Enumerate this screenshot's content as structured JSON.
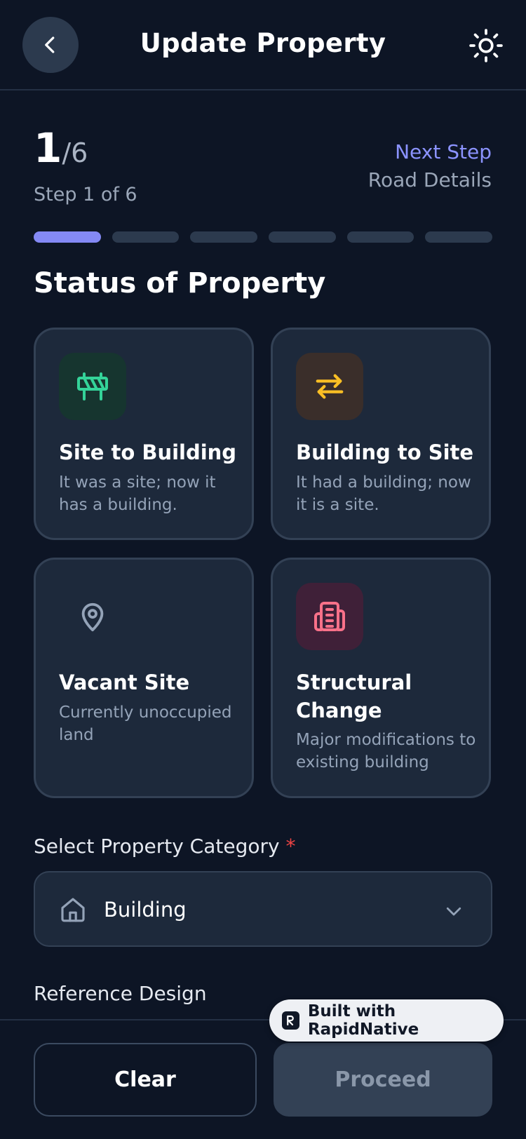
{
  "header": {
    "title": "Update Property",
    "back_icon": "chevron-left-icon",
    "theme_icon": "sun-icon"
  },
  "step": {
    "current": "1",
    "total_text": "/6",
    "subtitle": "Step 1 of 6",
    "next_label": "Next Step",
    "next_name": "Road Details",
    "progress_segments": 6,
    "progress_completed": 1
  },
  "section_title": "Status of Property",
  "status_options": [
    {
      "title": "Site to Building",
      "description": "It was a site; now it has a building.",
      "icon": "barrier-icon",
      "icon_color": "#34d399",
      "icon_bg": "#16352f"
    },
    {
      "title": "Building to Site",
      "description": "It had a building; now it is a site.",
      "icon": "swap-arrows-icon",
      "icon_color": "#fbbf24",
      "icon_bg": "#3a2e2a"
    },
    {
      "title": "Vacant Site",
      "description": "Currently unoccupied land",
      "icon": "map-pin-icon",
      "icon_color": "#94a3b8",
      "icon_bg": "transparent"
    },
    {
      "title": "Structural Change",
      "description": "Major modifications to existing building",
      "icon": "building-icon",
      "icon_color": "#f87189",
      "icon_bg": "#3f2038"
    }
  ],
  "category": {
    "label": "Select Property Category",
    "required_mark": "*",
    "value": "Building",
    "icon": "home-icon"
  },
  "reference_design_label": "Reference Design",
  "footer": {
    "clear_label": "Clear",
    "proceed_label": "Proceed"
  },
  "badge": {
    "text": "Built with RapidNative"
  },
  "colors": {
    "background": "#0d1525",
    "card": "#1d293b",
    "accent": "#8489f5",
    "required": "#ef4444"
  }
}
